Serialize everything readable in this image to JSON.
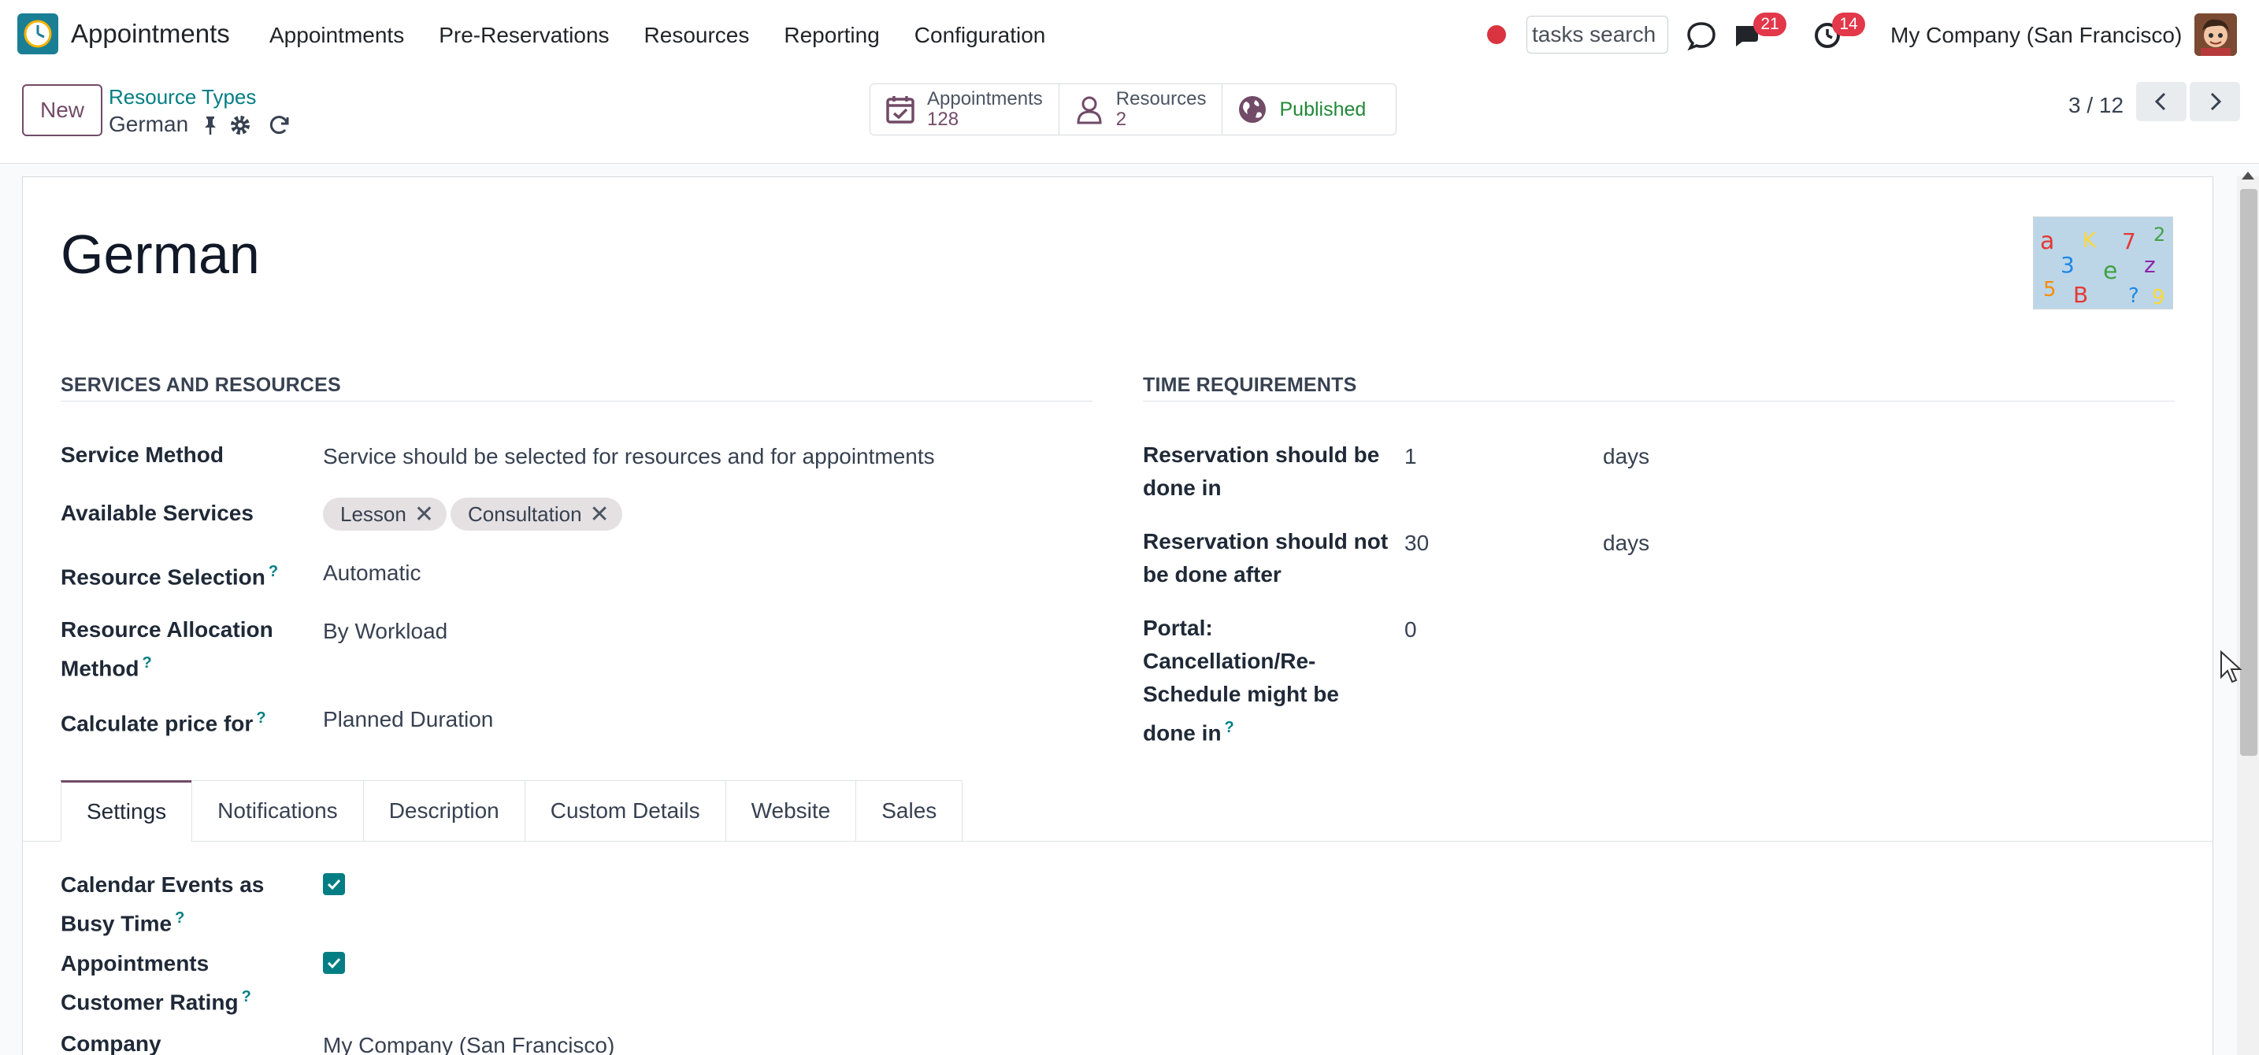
{
  "navbar": {
    "app_name": "Appointments",
    "menu": [
      "Appointments",
      "Pre-Reservations",
      "Resources",
      "Reporting",
      "Configuration"
    ],
    "search_placeholder": "tasks search",
    "messages_count": "21",
    "activities_count": "14",
    "company": "My Company (San Francisco)"
  },
  "control_panel": {
    "new_label": "New",
    "breadcrumb_parent": "Resource Types",
    "record_title": "German",
    "smart_buttons": {
      "appointments_label": "Appointments",
      "appointments_count": "128",
      "resources_label": "Resources",
      "resources_count": "2",
      "published_label": "Published"
    },
    "pager": "3 / 12"
  },
  "form": {
    "name": "German",
    "services_section": "SERVICES AND RESOURCES",
    "time_section": "TIME REQUIREMENTS",
    "service_method_label": "Service Method",
    "service_method_value": "Service should be selected for resources and for appointments",
    "available_services_label": "Available Services",
    "available_services": [
      "Lesson",
      "Consultation"
    ],
    "resource_selection_label": "Resource Selection",
    "resource_selection_value": "Automatic",
    "allocation_label_1": "Resource Allocation",
    "allocation_label_2": "Method",
    "allocation_value": "By Workload",
    "price_label": "Calculate price for",
    "price_value": "Planned Duration",
    "res_done_in_label_1": "Reservation should be",
    "res_done_in_label_2": "done in",
    "res_done_in_value": "1",
    "res_done_in_unit": "days",
    "res_not_after_label_1": "Reservation should not",
    "res_not_after_label_2": "be done after",
    "res_not_after_value": "30",
    "res_not_after_unit": "days",
    "portal_label_1": "Portal:",
    "portal_label_2": "Cancellation/Re-",
    "portal_label_3": "Schedule might be",
    "portal_label_4": "done in",
    "portal_value": "0",
    "help_mark": "?"
  },
  "tabs": [
    "Settings",
    "Notifications",
    "Description",
    "Custom Details",
    "Website",
    "Sales"
  ],
  "settings": {
    "cal_busy_label_1": "Calendar Events as",
    "cal_busy_label_2": "Busy Time",
    "rating_label_1": "Appointments",
    "rating_label_2": "Customer Rating",
    "company_label": "Company",
    "company_value": "My Company (San Francisco)"
  },
  "colors": {
    "brand": "#714b67",
    "accent": "#017e84",
    "badge": "#e2384a",
    "published": "#218838"
  }
}
